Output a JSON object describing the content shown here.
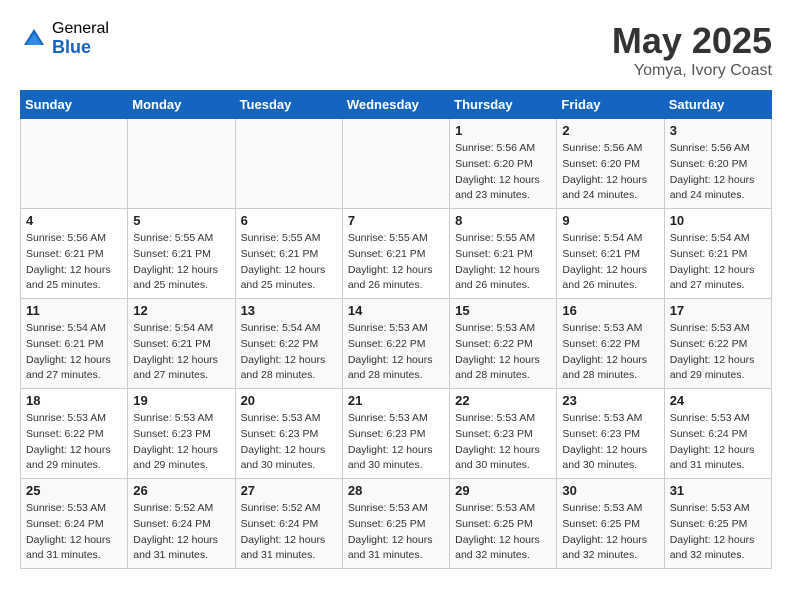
{
  "logo": {
    "general": "General",
    "blue": "Blue"
  },
  "title": "May 2025",
  "location": "Yomya, Ivory Coast",
  "days_of_week": [
    "Sunday",
    "Monday",
    "Tuesday",
    "Wednesday",
    "Thursday",
    "Friday",
    "Saturday"
  ],
  "weeks": [
    [
      {
        "day": "",
        "info": ""
      },
      {
        "day": "",
        "info": ""
      },
      {
        "day": "",
        "info": ""
      },
      {
        "day": "",
        "info": ""
      },
      {
        "day": "1",
        "info": "Sunrise: 5:56 AM\nSunset: 6:20 PM\nDaylight: 12 hours\nand 23 minutes."
      },
      {
        "day": "2",
        "info": "Sunrise: 5:56 AM\nSunset: 6:20 PM\nDaylight: 12 hours\nand 24 minutes."
      },
      {
        "day": "3",
        "info": "Sunrise: 5:56 AM\nSunset: 6:20 PM\nDaylight: 12 hours\nand 24 minutes."
      }
    ],
    [
      {
        "day": "4",
        "info": "Sunrise: 5:56 AM\nSunset: 6:21 PM\nDaylight: 12 hours\nand 25 minutes."
      },
      {
        "day": "5",
        "info": "Sunrise: 5:55 AM\nSunset: 6:21 PM\nDaylight: 12 hours\nand 25 minutes."
      },
      {
        "day": "6",
        "info": "Sunrise: 5:55 AM\nSunset: 6:21 PM\nDaylight: 12 hours\nand 25 minutes."
      },
      {
        "day": "7",
        "info": "Sunrise: 5:55 AM\nSunset: 6:21 PM\nDaylight: 12 hours\nand 26 minutes."
      },
      {
        "day": "8",
        "info": "Sunrise: 5:55 AM\nSunset: 6:21 PM\nDaylight: 12 hours\nand 26 minutes."
      },
      {
        "day": "9",
        "info": "Sunrise: 5:54 AM\nSunset: 6:21 PM\nDaylight: 12 hours\nand 26 minutes."
      },
      {
        "day": "10",
        "info": "Sunrise: 5:54 AM\nSunset: 6:21 PM\nDaylight: 12 hours\nand 27 minutes."
      }
    ],
    [
      {
        "day": "11",
        "info": "Sunrise: 5:54 AM\nSunset: 6:21 PM\nDaylight: 12 hours\nand 27 minutes."
      },
      {
        "day": "12",
        "info": "Sunrise: 5:54 AM\nSunset: 6:21 PM\nDaylight: 12 hours\nand 27 minutes."
      },
      {
        "day": "13",
        "info": "Sunrise: 5:54 AM\nSunset: 6:22 PM\nDaylight: 12 hours\nand 28 minutes."
      },
      {
        "day": "14",
        "info": "Sunrise: 5:53 AM\nSunset: 6:22 PM\nDaylight: 12 hours\nand 28 minutes."
      },
      {
        "day": "15",
        "info": "Sunrise: 5:53 AM\nSunset: 6:22 PM\nDaylight: 12 hours\nand 28 minutes."
      },
      {
        "day": "16",
        "info": "Sunrise: 5:53 AM\nSunset: 6:22 PM\nDaylight: 12 hours\nand 28 minutes."
      },
      {
        "day": "17",
        "info": "Sunrise: 5:53 AM\nSunset: 6:22 PM\nDaylight: 12 hours\nand 29 minutes."
      }
    ],
    [
      {
        "day": "18",
        "info": "Sunrise: 5:53 AM\nSunset: 6:22 PM\nDaylight: 12 hours\nand 29 minutes."
      },
      {
        "day": "19",
        "info": "Sunrise: 5:53 AM\nSunset: 6:23 PM\nDaylight: 12 hours\nand 29 minutes."
      },
      {
        "day": "20",
        "info": "Sunrise: 5:53 AM\nSunset: 6:23 PM\nDaylight: 12 hours\nand 30 minutes."
      },
      {
        "day": "21",
        "info": "Sunrise: 5:53 AM\nSunset: 6:23 PM\nDaylight: 12 hours\nand 30 minutes."
      },
      {
        "day": "22",
        "info": "Sunrise: 5:53 AM\nSunset: 6:23 PM\nDaylight: 12 hours\nand 30 minutes."
      },
      {
        "day": "23",
        "info": "Sunrise: 5:53 AM\nSunset: 6:23 PM\nDaylight: 12 hours\nand 30 minutes."
      },
      {
        "day": "24",
        "info": "Sunrise: 5:53 AM\nSunset: 6:24 PM\nDaylight: 12 hours\nand 31 minutes."
      }
    ],
    [
      {
        "day": "25",
        "info": "Sunrise: 5:53 AM\nSunset: 6:24 PM\nDaylight: 12 hours\nand 31 minutes."
      },
      {
        "day": "26",
        "info": "Sunrise: 5:52 AM\nSunset: 6:24 PM\nDaylight: 12 hours\nand 31 minutes."
      },
      {
        "day": "27",
        "info": "Sunrise: 5:52 AM\nSunset: 6:24 PM\nDaylight: 12 hours\nand 31 minutes."
      },
      {
        "day": "28",
        "info": "Sunrise: 5:53 AM\nSunset: 6:25 PM\nDaylight: 12 hours\nand 31 minutes."
      },
      {
        "day": "29",
        "info": "Sunrise: 5:53 AM\nSunset: 6:25 PM\nDaylight: 12 hours\nand 32 minutes."
      },
      {
        "day": "30",
        "info": "Sunrise: 5:53 AM\nSunset: 6:25 PM\nDaylight: 12 hours\nand 32 minutes."
      },
      {
        "day": "31",
        "info": "Sunrise: 5:53 AM\nSunset: 6:25 PM\nDaylight: 12 hours\nand 32 minutes."
      }
    ]
  ]
}
